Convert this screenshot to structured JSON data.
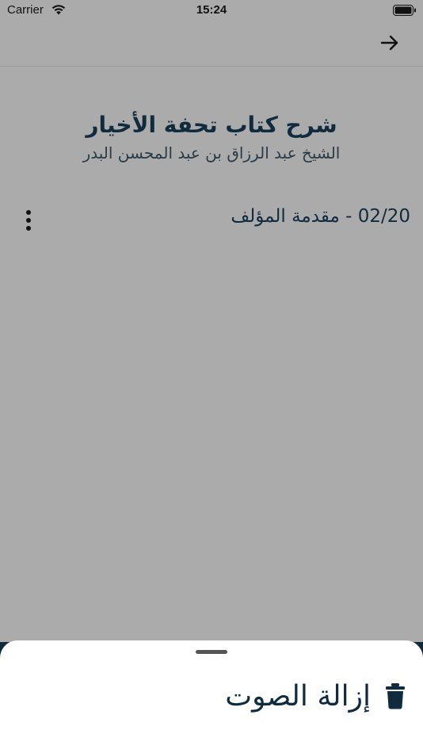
{
  "status_bar": {
    "carrier": "Carrier",
    "time": "15:24"
  },
  "icons": {
    "wifi": "wifi-icon",
    "battery": "battery-icon",
    "back": "arrow-right-icon",
    "more": "more-vertical-icon",
    "trash": "trash-icon"
  },
  "header": {
    "title": "شرح كتاب تحفة الأخيار",
    "author": "الشيخ عبد الرزاق بن عبد المحسن البدر"
  },
  "lessons": [
    {
      "title": "02/20 - مقدمة المؤلف"
    }
  ],
  "sheet": {
    "action_label": "إزالة الصوت"
  },
  "colors": {
    "overlay": "#ababab",
    "text_primary": "#0f2b3d",
    "sheet_bg": "#ffffff"
  }
}
